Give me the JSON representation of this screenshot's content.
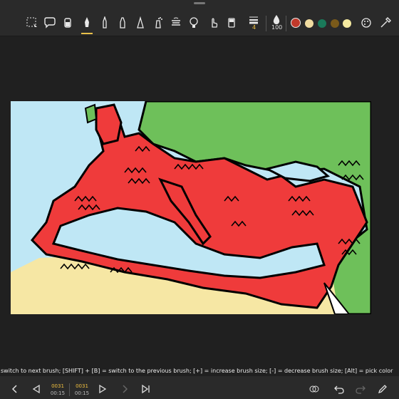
{
  "toolbar": {
    "brush_size": "4",
    "opacity": "100",
    "tools": [
      "lasso-select-icon",
      "speech-bubble-icon",
      "bucket-icon",
      "ink-pen-icon",
      "pencil-icon",
      "marker-icon",
      "calligraphy-pen-icon",
      "airbrush-icon",
      "stamp-icon",
      "light-bulb-icon",
      "finger-smudge-icon",
      "eraser-icon"
    ],
    "colors": [
      "#c0392b",
      "#f0dca0",
      "#1a7a5a",
      "#7a5a1a",
      "#f5eaa0"
    ]
  },
  "hint": "switch to next brush; [SHIFT] + [B] = switch to the previous brush; [+] = increase brush size; [-] = decrease brush size; [Alt] = pick color",
  "timeline": {
    "frame_a": "0031",
    "time_a": "00:15",
    "frame_b": "0031",
    "time_b": "00:15"
  }
}
